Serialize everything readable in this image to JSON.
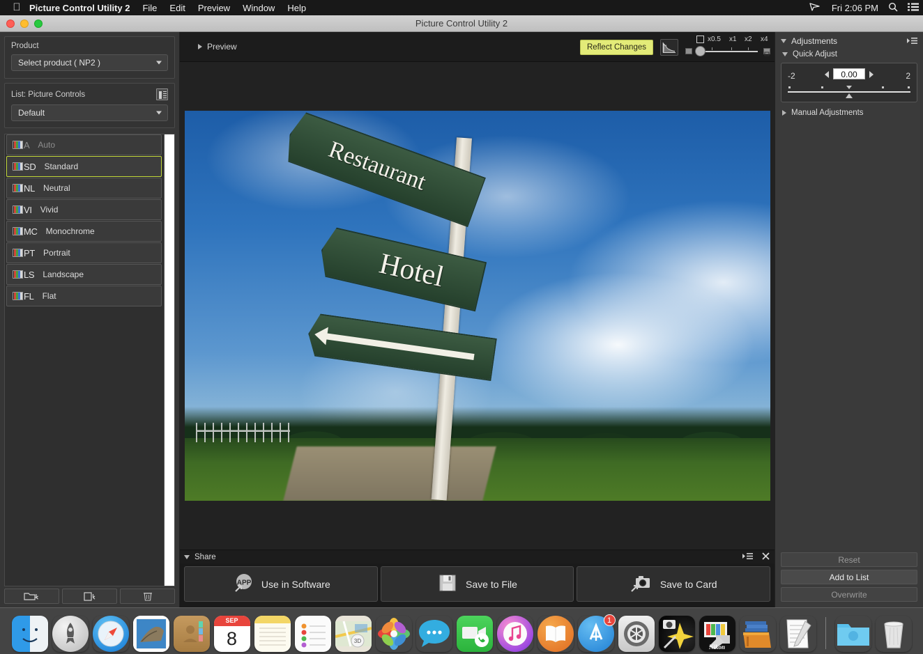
{
  "menubar": {
    "apple_icon": "apple-logo",
    "app_title": "Picture Control Utility 2",
    "items": [
      "File",
      "Edit",
      "Preview",
      "Window",
      "Help"
    ],
    "clock": "Fri 2:06 PM",
    "right_icons": [
      "airplay-icon",
      "search-icon",
      "notification-center-icon"
    ]
  },
  "window": {
    "title": "Picture Control Utility 2"
  },
  "left_panel": {
    "product": {
      "label": "Product",
      "selected": "Select product ( NP2 )"
    },
    "list": {
      "label": "List: Picture Controls",
      "filter_selected": "Default",
      "items": [
        {
          "abbr": "A",
          "name": "Auto",
          "state": "disabled"
        },
        {
          "abbr": "SD",
          "name": "Standard",
          "state": "selected"
        },
        {
          "abbr": "NL",
          "name": "Neutral",
          "state": "normal"
        },
        {
          "abbr": "VI",
          "name": "Vivid",
          "state": "normal"
        },
        {
          "abbr": "MC",
          "name": "Monochrome",
          "state": "normal"
        },
        {
          "abbr": "PT",
          "name": "Portrait",
          "state": "normal"
        },
        {
          "abbr": "LS",
          "name": "Landscape",
          "state": "normal"
        },
        {
          "abbr": "FL",
          "name": "Flat",
          "state": "normal"
        }
      ]
    },
    "bottom_buttons": [
      "open-folder-icon",
      "new-document-icon",
      "delete-trash-icon"
    ]
  },
  "center": {
    "preview": {
      "label": "Preview"
    },
    "reflect_changes": "Reflect Changes",
    "histogram_icon": "histogram-icon",
    "zoom": {
      "fit_icon": "fit-to-window-icon",
      "labels": [
        "x0.5",
        "x1",
        "x2",
        "x4"
      ],
      "current": "x0.5"
    },
    "share": {
      "label": "Share",
      "buttons": [
        {
          "icon": "app-export-icon",
          "label": "Use in Software"
        },
        {
          "icon": "floppy-save-icon",
          "label": "Save to File"
        },
        {
          "icon": "camera-card-icon",
          "label": "Save to Card"
        }
      ],
      "panel_menu_icon": "panel-menu-icon",
      "close_icon": "close-icon"
    }
  },
  "right_panel": {
    "adjustments": {
      "label": "Adjustments",
      "menu_icon": "panel-menu-icon"
    },
    "quick_adjust": {
      "label": "Quick Adjust",
      "min": "-2",
      "max": "2",
      "value": "0.00"
    },
    "manual_adjustments": {
      "label": "Manual Adjustments"
    },
    "buttons": [
      {
        "label": "Reset",
        "state": "disabled"
      },
      {
        "label": "Add to List",
        "state": "enabled"
      },
      {
        "label": "Overwrite",
        "state": "disabled"
      }
    ]
  },
  "photo": {
    "sign_restaurant": "Restaurant",
    "sign_hotel": "Hotel",
    "sign_arrow": "arrow-sign"
  },
  "dock": {
    "items": [
      {
        "name": "finder",
        "running": true
      },
      {
        "name": "launchpad",
        "running": false
      },
      {
        "name": "safari",
        "running": false
      },
      {
        "name": "mail",
        "running": false
      },
      {
        "name": "contacts",
        "running": false
      },
      {
        "name": "calendar",
        "running": false,
        "badge_text": "8",
        "badge_month": "SEP"
      },
      {
        "name": "notes",
        "running": false
      },
      {
        "name": "reminders",
        "running": false
      },
      {
        "name": "maps",
        "running": false
      },
      {
        "name": "photos",
        "running": false
      },
      {
        "name": "messages",
        "running": false
      },
      {
        "name": "facetime",
        "running": false
      },
      {
        "name": "itunes",
        "running": false
      },
      {
        "name": "ibooks",
        "running": false
      },
      {
        "name": "app-store",
        "running": false,
        "badge": "1"
      },
      {
        "name": "system-preferences",
        "running": false
      },
      {
        "name": "capture-nx",
        "running": false
      },
      {
        "name": "picture-control-utility",
        "running": true,
        "label": "Nikon"
      },
      {
        "name": "stacks-folder",
        "running": true
      },
      {
        "name": "textedit",
        "running": true
      }
    ],
    "right_items": [
      {
        "name": "downloads-folder"
      },
      {
        "name": "trash"
      }
    ]
  }
}
